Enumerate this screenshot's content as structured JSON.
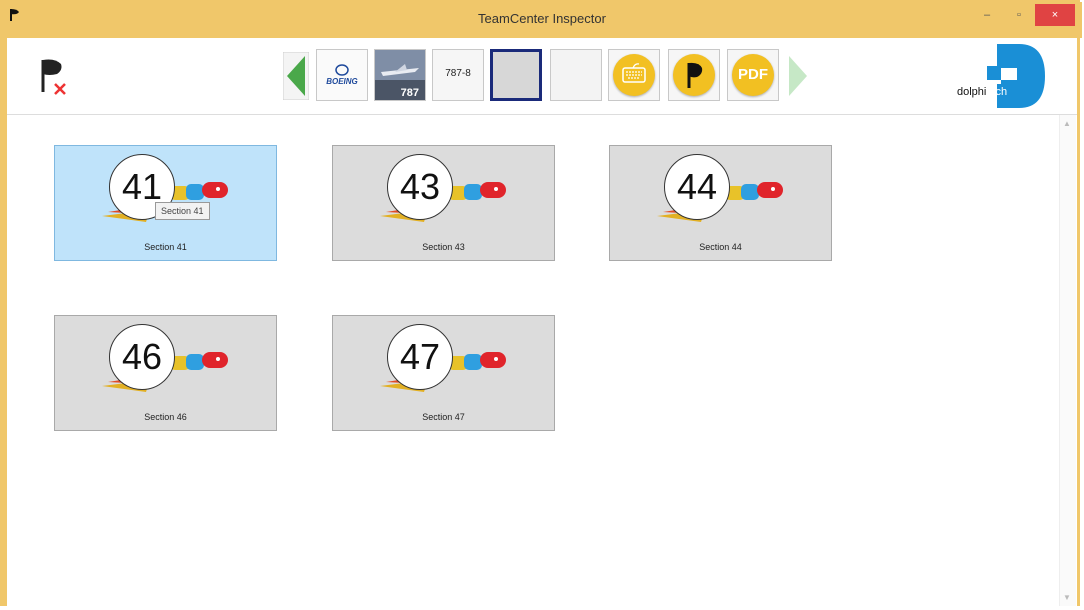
{
  "window": {
    "title": "TeamCenter Inspector",
    "min_glyph": "–",
    "max_glyph": "▫",
    "close_glyph": "×"
  },
  "toolbar": {
    "exit_icon": "flag-exit-icon",
    "back_icon": "green-left-arrow",
    "forward_icon": "green-right-arrow-disabled",
    "thumbs": [
      {
        "label": "BOEING",
        "kind": "boeing-logo"
      },
      {
        "label": "787",
        "kind": "aircraft-photo"
      },
      {
        "label": "787-8",
        "kind": "text"
      },
      {
        "label": "",
        "kind": "selected-empty"
      },
      {
        "label": "",
        "kind": "empty"
      }
    ],
    "keyboard_icon": "keyboard-icon",
    "scanner_icon": "scanner-icon",
    "pdf_label": "PDF",
    "logo_text_a": "dolphi",
    "logo_text_b": "tech"
  },
  "sections": [
    {
      "number": "41",
      "label": "Section 41",
      "active": true
    },
    {
      "number": "43",
      "label": "Section 43",
      "active": false
    },
    {
      "number": "44",
      "label": "Section 44",
      "active": false
    },
    {
      "number": "46",
      "label": "Section 46",
      "active": false
    },
    {
      "number": "47",
      "label": "Section 47",
      "active": false
    }
  ],
  "tooltip": "Section 41",
  "colors": {
    "titlebar": "#f0c76a",
    "active_card": "#bfe3fa",
    "card": "#dcdcdc",
    "accent_blue": "#1a8fd6",
    "close": "#e04343"
  }
}
